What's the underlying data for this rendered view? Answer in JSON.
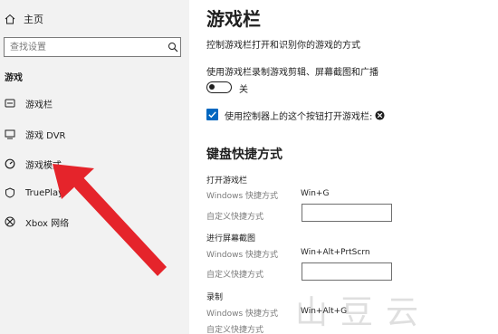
{
  "sidebar": {
    "home_label": "主页",
    "search_placeholder": "查找设置",
    "section_title": "游戏",
    "items": [
      {
        "label": "游戏栏",
        "icon": "game-bar-icon"
      },
      {
        "label": "游戏 DVR",
        "icon": "game-dvr-icon"
      },
      {
        "label": "游戏模式",
        "icon": "game-mode-icon"
      },
      {
        "label": "TruePlay",
        "icon": "trueplay-icon"
      },
      {
        "label": "Xbox 网络",
        "icon": "xbox-icon"
      }
    ]
  },
  "main": {
    "title": "游戏栏",
    "description": "控制游戏栏打开和识别你的游戏的方式",
    "record_option_label": "使用游戏栏录制游戏剪辑、屏幕截图和广播",
    "record_toggle_state": "关",
    "record_toggle_on": false,
    "controller_option_label": "使用控制器上的这个按钮打开游戏栏:",
    "controller_option_checked": true,
    "shortcuts_heading": "键盘快捷方式",
    "shortcut_groups": [
      {
        "title": "打开游戏栏",
        "windows_label": "Windows 快捷方式",
        "windows_value": "Win+G",
        "custom_label": "自定义快捷方式",
        "custom_value": ""
      },
      {
        "title": "进行屏幕截图",
        "windows_label": "Windows 快捷方式",
        "windows_value": "Win+Alt+PrtScrn",
        "custom_label": "自定义快捷方式",
        "custom_value": ""
      },
      {
        "title": "录制",
        "windows_label": "Windows 快捷方式",
        "windows_value": "Win+Alt+G",
        "custom_label": "自定义快捷方式",
        "custom_value": ""
      }
    ]
  },
  "colors": {
    "accent": "#0067c0",
    "annotation_arrow": "#e5242b",
    "sidebar_bg": "#f2f2f2"
  },
  "watermark_text": "山豆云"
}
